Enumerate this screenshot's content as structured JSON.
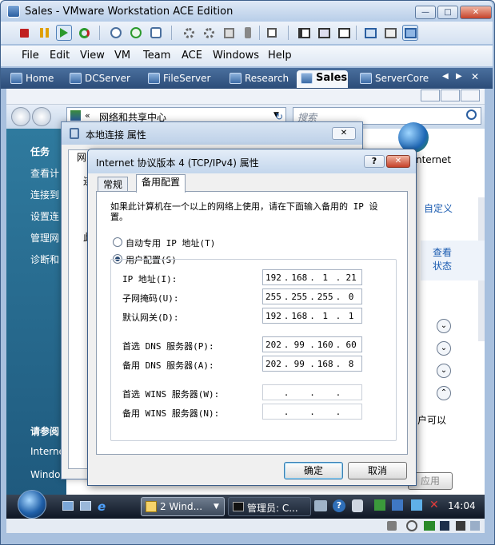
{
  "vmware": {
    "title": "Sales - VMware Workstation ACE Edition",
    "window_controls": {
      "minimize": "—",
      "maximize": "□",
      "close": "✕"
    },
    "menu": [
      "File",
      "Edit",
      "View",
      "VM",
      "Team",
      "ACE",
      "Windows",
      "Help"
    ],
    "tabs": [
      {
        "label": "Home",
        "active": false
      },
      {
        "label": "DCServer",
        "active": false
      },
      {
        "label": "FileServer",
        "active": false
      },
      {
        "label": "Research",
        "active": false
      },
      {
        "label": "Sales",
        "active": true
      },
      {
        "label": "ServerCore",
        "active": false
      }
    ],
    "tab_nav": {
      "prev": "◀",
      "next": "▶",
      "close": "✕"
    }
  },
  "guest": {
    "address": {
      "back_glyph": "«",
      "path": "网络和共享中心"
    },
    "search": {
      "placeholder": "搜索"
    },
    "left_pane": {
      "heading": "任务",
      "items": [
        "查看计",
        "连接到",
        "设置连",
        "管理网",
        "诊断和"
      ],
      "see_also": "请参阅",
      "bottom_items": [
        "Interne",
        "Windows 防"
      ]
    },
    "right_pane": {
      "internet": "nternet",
      "customize": "自定义",
      "view_status_1": "查看",
      "view_status_2": "状态",
      "user_can": "户可以",
      "apply": "应用"
    },
    "taskbar": {
      "task_windows": "2 Wind...",
      "task_cmd": "管理员: C...",
      "time": "14:04"
    }
  },
  "local_dialog": {
    "title": "本地连接 属性",
    "close": "✕",
    "frag_1": "网",
    "frag_2": "连",
    "frag_3": "此"
  },
  "ip_dialog": {
    "title": "Internet 协议版本 4 (TCP/IPv4) 属性",
    "help": "?",
    "close": "✕",
    "tabs": [
      "常规",
      "备用配置"
    ],
    "active_tab": "备用配置",
    "description": "如果此计算机在一个以上的网络上使用，请在下面输入备用的 IP 设置。",
    "radio_auto": "自动专用 IP 地址(T)",
    "radio_user": "用户配置(S)",
    "selected": "用户配置(S)",
    "fields": [
      {
        "label": "IP 地址(I):",
        "octets": [
          "192",
          "168",
          "1",
          "21"
        ]
      },
      {
        "label": "子网掩码(U):",
        "octets": [
          "255",
          "255",
          "255",
          "0"
        ]
      },
      {
        "label": "默认网关(D):",
        "octets": [
          "192",
          "168",
          "1",
          "1"
        ]
      },
      {
        "label": "首选 DNS 服务器(P):",
        "octets": [
          "202",
          "99",
          "160",
          "60"
        ]
      },
      {
        "label": "备用 DNS 服务器(A):",
        "octets": [
          "202",
          "99",
          "168",
          "8"
        ]
      },
      {
        "label": "首选 WINS 服务器(W):",
        "octets": [
          "",
          "",
          "",
          ""
        ]
      },
      {
        "label": "备用 WINS 服务器(N):",
        "octets": [
          "",
          "",
          "",
          ""
        ]
      }
    ],
    "ok": "确定",
    "cancel": "取消"
  }
}
